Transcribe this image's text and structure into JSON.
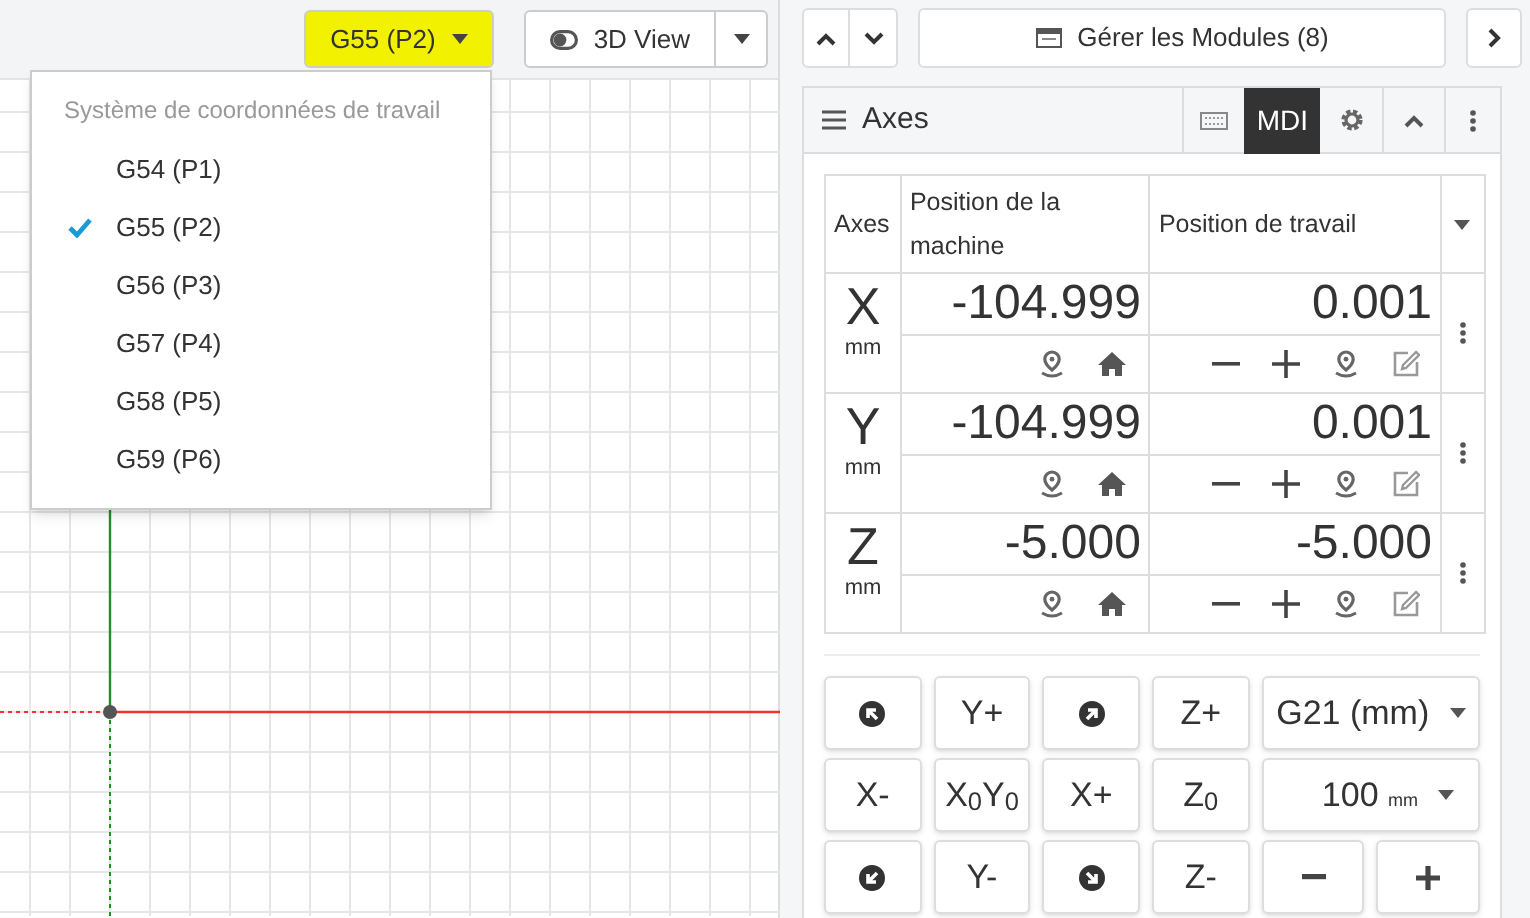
{
  "toolbar": {
    "wcs_button": {
      "label": "G55 (P2)",
      "highlighted": true
    },
    "view_button": {
      "label": "3D View"
    }
  },
  "wcs_menu": {
    "header": "Système de coordonnées de travail",
    "items": [
      {
        "label": "G54 (P1)",
        "selected": false
      },
      {
        "label": "G55 (P2)",
        "selected": true
      },
      {
        "label": "G56 (P3)",
        "selected": false
      },
      {
        "label": "G57 (P4)",
        "selected": false
      },
      {
        "label": "G58 (P5)",
        "selected": false
      },
      {
        "label": "G59 (P6)",
        "selected": false
      }
    ]
  },
  "module_bar": {
    "label": "Gérer les Modules (8)"
  },
  "axes_widget": {
    "title": "Axes",
    "mdi_label": "MDI",
    "mdi_selected": true,
    "table": {
      "columns": [
        "Axes",
        "Position de la machine",
        "Position de travail"
      ],
      "rows": [
        {
          "axis": "X",
          "unit": "mm",
          "machine": "-104.999",
          "work": "0.001"
        },
        {
          "axis": "Y",
          "unit": "mm",
          "machine": "-104.999",
          "work": "0.001"
        },
        {
          "axis": "Z",
          "unit": "mm",
          "machine": "-5.000",
          "work": "-5.000"
        }
      ]
    },
    "jog_rows": [
      [
        {
          "kind": "icon"
        },
        {
          "kind": "text",
          "label": "Y+"
        },
        {
          "kind": "icon"
        },
        {
          "kind": "text",
          "label": "Z+"
        },
        {
          "kind": "select",
          "label": "G21 (mm)"
        }
      ],
      [
        {
          "kind": "text",
          "label": "X-"
        },
        {
          "kind": "text",
          "label": "X$_{0}$Y$_{0}$"
        },
        {
          "kind": "text",
          "label": "X+"
        },
        {
          "kind": "text",
          "label": "Z$_{0}$"
        },
        {
          "kind": "step",
          "label": "100",
          "unit": "mm"
        }
      ],
      [
        {
          "kind": "icon"
        },
        {
          "kind": "text",
          "label": "Y-"
        },
        {
          "kind": "icon"
        },
        {
          "kind": "text",
          "label": "Z-"
        },
        {
          "kind": "icon"
        },
        {
          "kind": "icon"
        }
      ]
    ]
  }
}
